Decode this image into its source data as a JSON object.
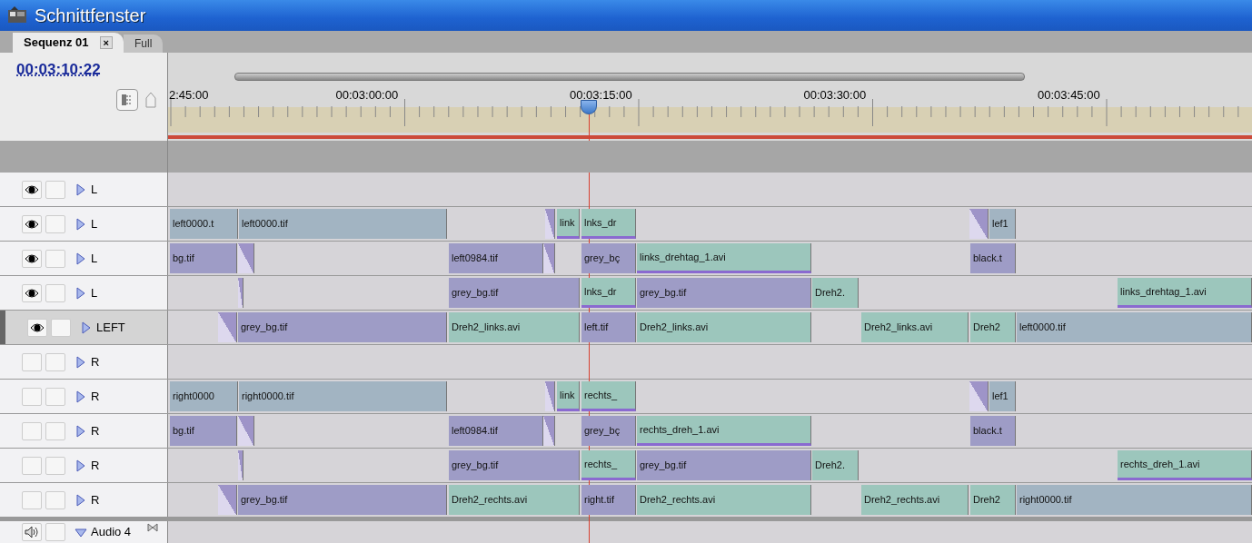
{
  "window": {
    "title": "Schnittfenster"
  },
  "tabs": [
    {
      "label": "Sequenz 01",
      "close": "×",
      "selected": true
    },
    {
      "label": "Full",
      "selected": false
    }
  ],
  "timecode": "00:03:10:22",
  "ruler": {
    "labels": [
      "2:45:00",
      "00:03:00:00",
      "00:03:15:00",
      "00:03:30:00",
      "00:03:45:00"
    ]
  },
  "playhead": {
    "level": 0.388
  },
  "tracks": [
    {
      "kind": "video",
      "label": "L",
      "visible": true,
      "selected": false,
      "expanded": false
    },
    {
      "kind": "video",
      "label": "L",
      "visible": true,
      "selected": false,
      "expanded": false,
      "clips": [
        {
          "kind": "sequence",
          "name": "left0000.t"
        },
        {
          "kind": "sequence",
          "name": "left0000.tif"
        },
        {
          "kind": "transition"
        },
        {
          "kind": "linked-video",
          "name": "link"
        },
        {
          "kind": "linked-video",
          "name": "lnks_dr"
        },
        {
          "kind": "transition"
        },
        {
          "kind": "sequence",
          "name": "lef1"
        }
      ]
    },
    {
      "kind": "video",
      "label": "L",
      "visible": true,
      "selected": false,
      "expanded": false,
      "clips": [
        {
          "kind": "still",
          "name": "bg.tif"
        },
        {
          "kind": "transition"
        },
        {
          "kind": "still",
          "name": "left0984.tif"
        },
        {
          "kind": "transition"
        },
        {
          "kind": "still",
          "name": "grey_bç"
        },
        {
          "kind": "linked-video",
          "name": "links_drehtag_1.avi"
        },
        {
          "kind": "still",
          "name": "black.t"
        }
      ]
    },
    {
      "kind": "video",
      "label": "L",
      "visible": true,
      "selected": false,
      "expanded": false,
      "clips": [
        {
          "kind": "transition"
        },
        {
          "kind": "still",
          "name": "grey_bg.tif"
        },
        {
          "kind": "linked-video",
          "name": "lnks_dr"
        },
        {
          "kind": "still",
          "name": "grey_bg.tif"
        },
        {
          "kind": "video",
          "name": "Dreh2."
        },
        {
          "kind": "linked-video",
          "name": "links_drehtag_1.avi"
        }
      ]
    },
    {
      "kind": "video",
      "label": "LEFT",
      "visible": true,
      "selected": true,
      "expanded": false,
      "clips": [
        {
          "kind": "transition"
        },
        {
          "kind": "still",
          "name": "grey_bg.tif"
        },
        {
          "kind": "video",
          "name": "Dreh2_links.avi"
        },
        {
          "kind": "still",
          "name": "left.tif"
        },
        {
          "kind": "video",
          "name": "Dreh2_links.avi"
        },
        {
          "kind": "video",
          "name": "Dreh2_links.avi"
        },
        {
          "kind": "video",
          "name": "Dreh2"
        },
        {
          "kind": "sequence",
          "name": "left0000.tif"
        }
      ]
    },
    {
      "kind": "video",
      "label": "R",
      "visible": false,
      "selected": false,
      "expanded": false
    },
    {
      "kind": "video",
      "label": "R",
      "visible": false,
      "selected": false,
      "expanded": false,
      "clips": [
        {
          "kind": "sequence",
          "name": "right0000"
        },
        {
          "kind": "sequence",
          "name": "right0000.tif"
        },
        {
          "kind": "transition"
        },
        {
          "kind": "linked-video",
          "name": "link"
        },
        {
          "kind": "linked-video",
          "name": "rechts_"
        },
        {
          "kind": "transition"
        },
        {
          "kind": "sequence",
          "name": "lef1"
        }
      ]
    },
    {
      "kind": "video",
      "label": "R",
      "visible": false,
      "selected": false,
      "expanded": false,
      "clips": [
        {
          "kind": "still",
          "name": "bg.tif"
        },
        {
          "kind": "transition"
        },
        {
          "kind": "still",
          "name": "left0984.tif"
        },
        {
          "kind": "transition"
        },
        {
          "kind": "still",
          "name": "grey_bç"
        },
        {
          "kind": "linked-video",
          "name": "rechts_dreh_1.avi"
        },
        {
          "kind": "still",
          "name": "black.t"
        }
      ]
    },
    {
      "kind": "video",
      "label": "R",
      "visible": false,
      "selected": false,
      "expanded": false,
      "clips": [
        {
          "kind": "transition"
        },
        {
          "kind": "still",
          "name": "grey_bg.tif"
        },
        {
          "kind": "linked-video",
          "name": "rechts_"
        },
        {
          "kind": "still",
          "name": "grey_bg.tif"
        },
        {
          "kind": "video",
          "name": "Dreh2."
        },
        {
          "kind": "linked-video",
          "name": "rechts_dreh_1.avi"
        }
      ]
    },
    {
      "kind": "video",
      "label": "R",
      "visible": false,
      "selected": false,
      "expanded": false,
      "clips": [
        {
          "kind": "transition"
        },
        {
          "kind": "still",
          "name": "grey_bg.tif"
        },
        {
          "kind": "video",
          "name": "Dreh2_rechts.avi"
        },
        {
          "kind": "still",
          "name": "right.tif"
        },
        {
          "kind": "video",
          "name": "Dreh2_rechts.avi"
        },
        {
          "kind": "video",
          "name": "Dreh2_rechts.avi"
        },
        {
          "kind": "video",
          "name": "Dreh2"
        },
        {
          "kind": "sequence",
          "name": "right0000.tif"
        }
      ]
    },
    {
      "kind": "audio",
      "label": "Audio 4",
      "visible": true,
      "selected": false,
      "expanded": true
    }
  ]
}
